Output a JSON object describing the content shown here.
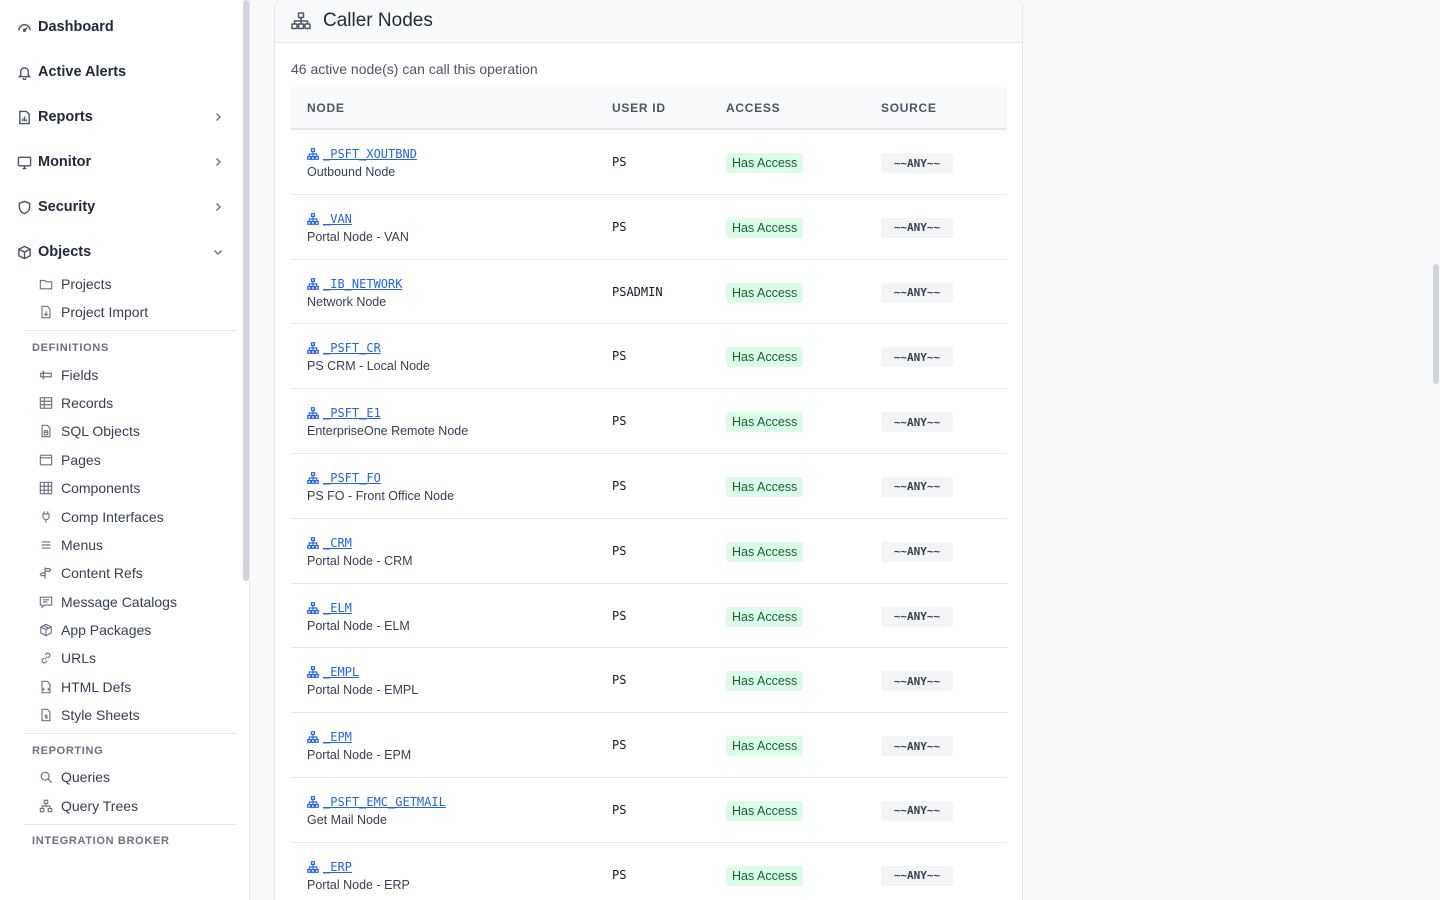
{
  "sidebar": {
    "top_items": [
      {
        "label": "Dashboard",
        "icon": "gauge-icon"
      },
      {
        "label": "Active Alerts",
        "icon": "bell-icon"
      },
      {
        "label": "Reports",
        "icon": "report-icon"
      },
      {
        "label": "Monitor",
        "icon": "monitor-icon"
      },
      {
        "label": "Security",
        "icon": "shield-icon"
      },
      {
        "label": "Objects",
        "icon": "cube-icon"
      }
    ],
    "objects_items": [
      {
        "label": "Projects",
        "icon": "folder-icon"
      },
      {
        "label": "Project Import",
        "icon": "file-import-icon"
      }
    ],
    "definitions_label": "DEFINITIONS",
    "definitions_items": [
      {
        "label": "Fields",
        "icon": "field-icon"
      },
      {
        "label": "Records",
        "icon": "table-icon"
      },
      {
        "label": "SQL Objects",
        "icon": "sql-file-icon"
      },
      {
        "label": "Pages",
        "icon": "page-window-icon"
      },
      {
        "label": "Components",
        "icon": "grid-icon"
      },
      {
        "label": "Comp Interfaces",
        "icon": "plug-icon"
      },
      {
        "label": "Menus",
        "icon": "menu-lines-icon"
      },
      {
        "label": "Content Refs",
        "icon": "signpost-icon"
      },
      {
        "label": "Message Catalogs",
        "icon": "message-icon"
      },
      {
        "label": "App Packages",
        "icon": "package-icon"
      },
      {
        "label": "URLs",
        "icon": "link-icon"
      },
      {
        "label": "HTML Defs",
        "icon": "html-file-icon"
      },
      {
        "label": "Style Sheets",
        "icon": "stylesheet-icon"
      }
    ],
    "reporting_label": "REPORTING",
    "reporting_items": [
      {
        "label": "Queries",
        "icon": "search-icon"
      },
      {
        "label": "Query Trees",
        "icon": "tree-icon"
      }
    ],
    "integration_label": "INTEGRATION BROKER"
  },
  "card": {
    "title": "Caller Nodes",
    "title_icon": "node-hierarchy-icon",
    "count_text": "46 active node(s) can call this operation",
    "columns": [
      "NODE",
      "USER ID",
      "ACCESS",
      "SOURCE"
    ],
    "rows": [
      {
        "node": "_PSFT_XOUTBND",
        "desc": "Outbound Node",
        "user": "PS",
        "access": "Has Access",
        "source": "~~ANY~~"
      },
      {
        "node": "_VAN",
        "desc": "Portal Node - VAN",
        "user": "PS",
        "access": "Has Access",
        "source": "~~ANY~~"
      },
      {
        "node": "_IB_NETWORK",
        "desc": "Network Node",
        "user": "PSADMIN",
        "access": "Has Access",
        "source": "~~ANY~~"
      },
      {
        "node": "_PSFT_CR",
        "desc": "PS CRM - Local Node",
        "user": "PS",
        "access": "Has Access",
        "source": "~~ANY~~"
      },
      {
        "node": "_PSFT_E1",
        "desc": "EnterpriseOne Remote Node",
        "user": "PS",
        "access": "Has Access",
        "source": "~~ANY~~"
      },
      {
        "node": "_PSFT_FO",
        "desc": "PS FO - Front Office Node",
        "user": "PS",
        "access": "Has Access",
        "source": "~~ANY~~"
      },
      {
        "node": "_CRM",
        "desc": "Portal Node - CRM",
        "user": "PS",
        "access": "Has Access",
        "source": "~~ANY~~"
      },
      {
        "node": "_ELM",
        "desc": "Portal Node - ELM",
        "user": "PS",
        "access": "Has Access",
        "source": "~~ANY~~"
      },
      {
        "node": "_EMPL",
        "desc": "Portal Node - EMPL",
        "user": "PS",
        "access": "Has Access",
        "source": "~~ANY~~"
      },
      {
        "node": "_EPM",
        "desc": "Portal Node - EPM",
        "user": "PS",
        "access": "Has Access",
        "source": "~~ANY~~"
      },
      {
        "node": "_PSFT_EMC_GETMAIL",
        "desc": "Get Mail Node",
        "user": "PS",
        "access": "Has Access",
        "source": "~~ANY~~"
      },
      {
        "node": "_ERP",
        "desc": "Portal Node - ERP",
        "user": "PS",
        "access": "Has Access",
        "source": "~~ANY~~"
      }
    ]
  },
  "colors": {
    "link": "#2563eb",
    "access_bg": "#dcfce7",
    "access_text": "#166534",
    "source_bg": "#f3f4f6"
  }
}
